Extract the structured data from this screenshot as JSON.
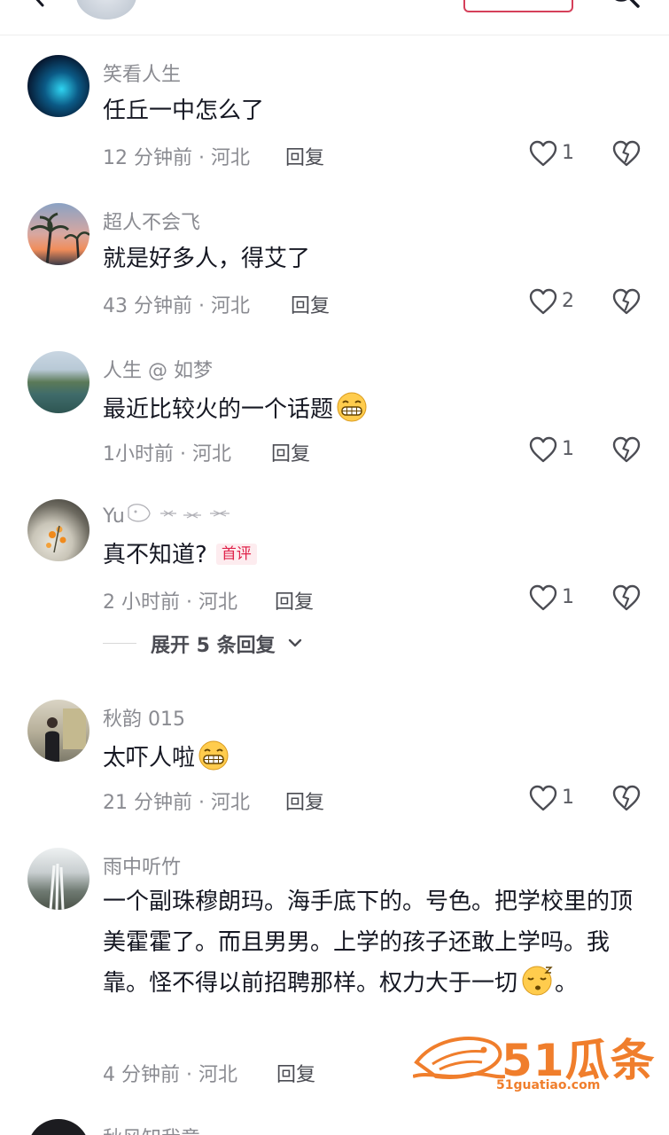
{
  "reply_label": "回复",
  "comments": [
    {
      "username": "笑看人生",
      "text": "任丘一中怎么了",
      "meta": "12 分钟前 · 河北",
      "likes": "1"
    },
    {
      "username": "超人不会飞",
      "text": "就是好多人，得艾了",
      "meta": "43 分钟前 · 河北",
      "likes": "2"
    },
    {
      "username": "人生 @ 如梦",
      "text": "最近比较火的一个话题",
      "meta": "1小时前 · 河北",
      "likes": "1"
    },
    {
      "username": "Yu",
      "text": "真不知道?",
      "badge": "首评",
      "meta": "2 小时前 · 河北",
      "likes": "1"
    },
    {
      "username": "秋韵 015",
      "text": "太吓人啦",
      "meta": "21 分钟前 · 河北",
      "likes": "1"
    },
    {
      "username": "雨中听竹",
      "text": "一个副珠穆朗玛。海手底下的。号色。把学校里的顶美霍霍了。而且男男。上学的孩子还敢上学吗。我靠。怪不得以前招聘那样。权力大于一切",
      "text_tail": "。",
      "meta": "4 分钟前 · 河北"
    },
    {
      "username": "秋风知我意"
    }
  ],
  "expand_label": "展开 5 条回复",
  "watermark": {
    "title": "51瓜条",
    "sub": "51guatiao.com"
  },
  "icons": [
    "back-icon",
    "search-icon",
    "like-icon",
    "dislike-icon",
    "chevron-down-icon",
    "grin-emoji",
    "sleepy-emoji"
  ]
}
